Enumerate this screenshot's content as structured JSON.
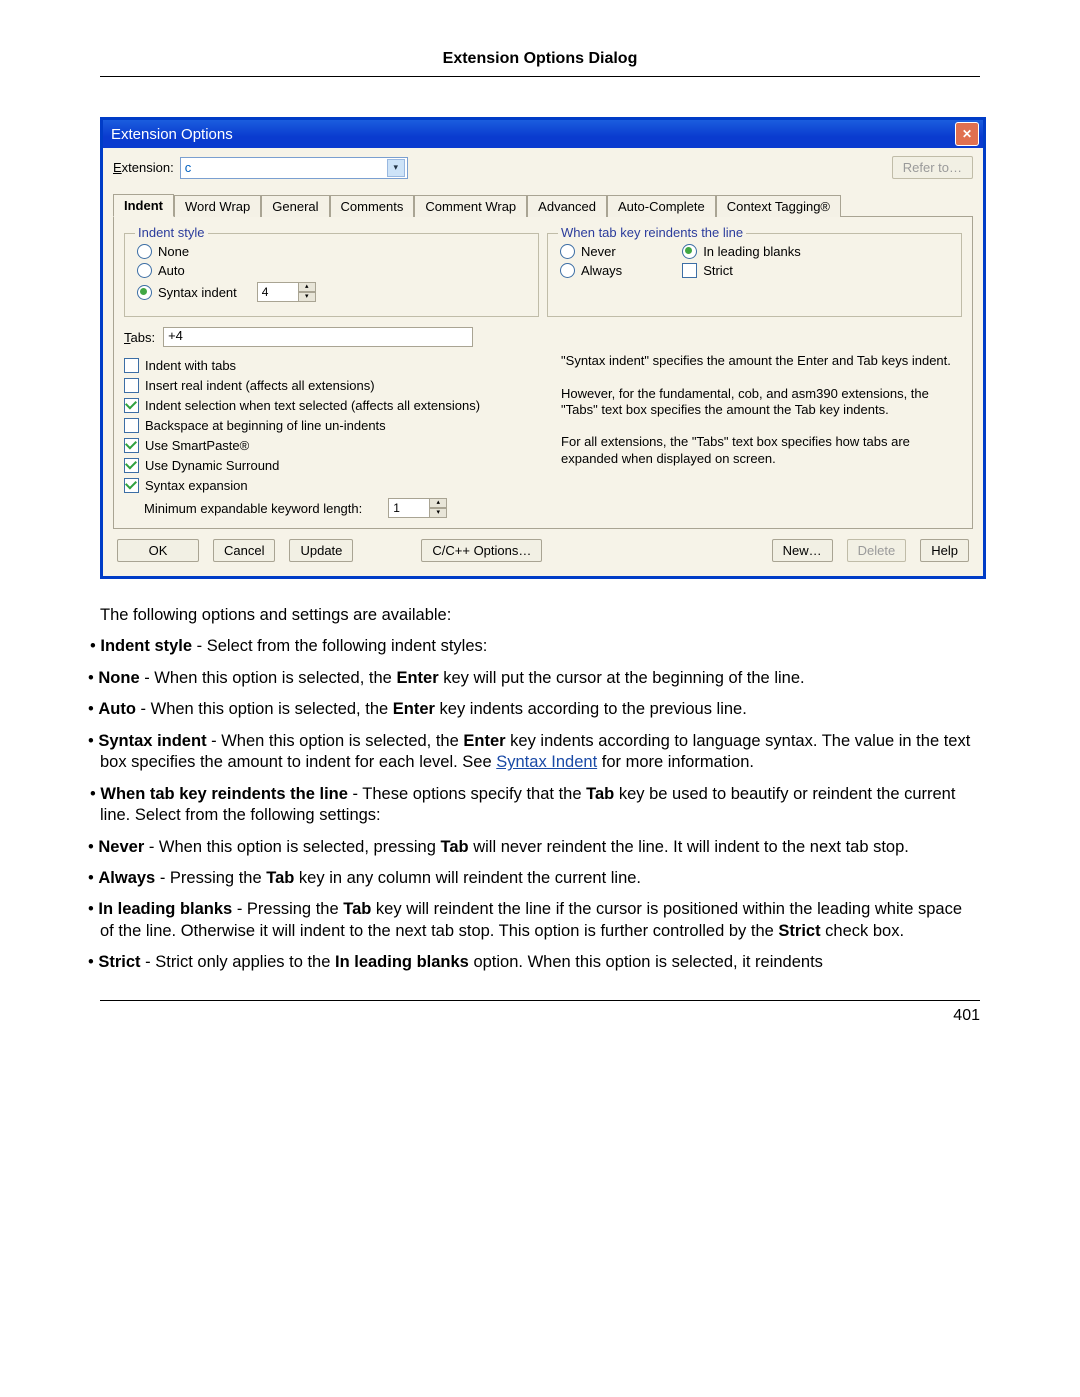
{
  "page": {
    "title": "Extension Options Dialog",
    "number": "401"
  },
  "dialog": {
    "title": "Extension Options",
    "extension_label": "Extension:",
    "extension_value": "c",
    "refer_label": "Refer to…",
    "tabs": [
      "Indent",
      "Word Wrap",
      "General",
      "Comments",
      "Comment Wrap",
      "Advanced",
      "Auto-Complete",
      "Context Tagging®"
    ],
    "indent_style": {
      "legend": "Indent style",
      "none": "None",
      "auto": "Auto",
      "syntax": "Syntax indent",
      "syntax_amount": "4"
    },
    "reindent": {
      "legend": "When tab key reindents the line",
      "never": "Never",
      "always": "Always",
      "leading": "In leading blanks",
      "strict": "Strict"
    },
    "tabs_label": "Tabs:",
    "tabs_value": "+4",
    "checks": {
      "indent_tabs": "Indent with tabs",
      "insert_real": "Insert real indent (affects all extensions)",
      "indent_sel": "Indent selection when text selected (affects all extensions)",
      "backspace": "Backspace at beginning of line un-indents",
      "smartpaste": "Use SmartPaste®",
      "dyn_surround": "Use Dynamic Surround",
      "syn_exp": "Syntax expansion",
      "min_label": "Minimum expandable keyword length:",
      "min_value": "1"
    },
    "help_text": {
      "p1": "\"Syntax indent\" specifies the amount the Enter and Tab  keys indent.",
      "p2": "However, for the fundamental, cob, and asm390 extensions, the \"Tabs\" text box specifies the amount the Tab key indents.",
      "p3": " For all extensions, the \"Tabs\" text box specifies how tabs are expanded when displayed on screen."
    },
    "buttons": {
      "ok": "OK",
      "cancel": "Cancel",
      "update": "Update",
      "lang_options": "C/C++ Options…",
      "new": "New…",
      "delete": "Delete",
      "help": "Help"
    }
  },
  "doc": {
    "intro": "The following options and settings are available:",
    "indent_style_head": "Indent style",
    "indent_style_tail": " - Select from the following indent styles:",
    "none_b": "None",
    "none_t": " - When this option is selected, the ",
    "enter_b": "Enter",
    "none_t2": " key will put the cursor at the beginning of the line.",
    "auto_b": "Auto",
    "auto_t": " - When this option is selected, the ",
    "auto_t2": " key indents according to the previous line.",
    "syn_b": "Syntax indent",
    "syn_t": " - When this option is selected, the ",
    "syn_t2": " key indents according to language syntax. The value in the text box specifies the amount to indent for each level. See ",
    "syn_link": "Syntax Indent",
    "syn_t3": " for more information.",
    "reindent_head": "When tab key reindents the line",
    "reindent_tail": " - These options specify that the ",
    "tab_b": "Tab",
    "reindent_tail2": " key be used to beautify or reindent the current line. Select from the following settings:",
    "never_b": "Never",
    "never_t": " - When this option is selected, pressing ",
    "never_t2": " will never reindent the line. It will indent to the next tab stop.",
    "always_b": "Always",
    "always_t": " - Pressing the ",
    "always_t2": " key in any column will reindent the current line.",
    "lead_b": "In leading blanks",
    "lead_t": " - Pressing the ",
    "lead_t2": " key will reindent the line if the cursor is positioned within the leading white space of the line. Otherwise it will indent to the next tab stop. This option is further controlled by the ",
    "strict_b": "Strict",
    "lead_t3": " check box.",
    "strict2_b": "Strict",
    "strict2_t": " - Strict only applies to the ",
    "strict2_mid": "In leading blanks",
    "strict2_t2": " option. When this option is selected, it reindents"
  }
}
